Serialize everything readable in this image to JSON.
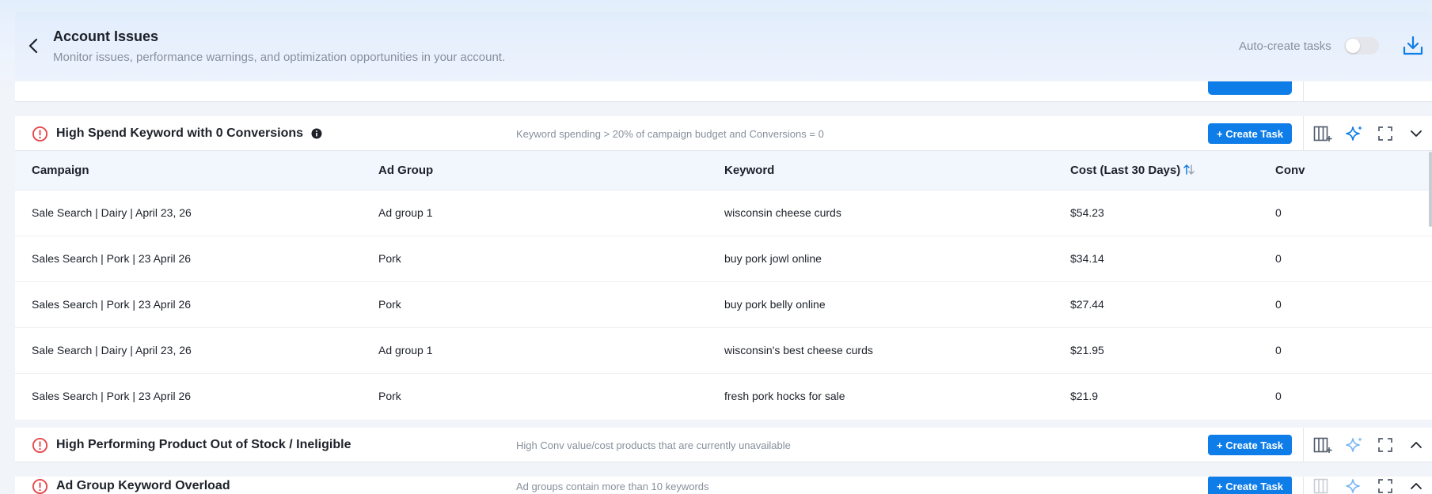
{
  "header": {
    "title": "Account Issues",
    "subtitle": "Monitor issues, performance warnings, and optimization opportunities in your account.",
    "auto_create_label": "Auto-create tasks",
    "auto_create_enabled": false
  },
  "colors": {
    "accent": "#0e7de8",
    "danger": "#e5484d",
    "muted_text": "#86909c"
  },
  "panels": [
    {
      "title": "High Spend Keyword with 0 Conversions",
      "description": "Keyword spending > 20% of campaign budget and Conversions = 0",
      "create_label": "+ Create Task",
      "expanded": true,
      "columns": [
        "Campaign",
        "Ad Group",
        "Keyword",
        "Cost (Last 30 Days)",
        "Conv"
      ],
      "rows": [
        [
          "Sale Search | Dairy | April 23, 26",
          "Ad group 1",
          "wisconsin cheese curds",
          "$54.23",
          "0"
        ],
        [
          "Sales Search | Pork | 23 April 26",
          "Pork",
          "buy pork jowl online",
          "$34.14",
          "0"
        ],
        [
          "Sales Search | Pork | 23 April 26",
          "Pork",
          "buy pork belly online",
          "$27.44",
          "0"
        ],
        [
          "Sale Search | Dairy | April 23, 26",
          "Ad group 1",
          "wisconsin's best cheese curds",
          "$21.95",
          "0"
        ],
        [
          "Sales Search | Pork | 23 April 26",
          "Pork",
          "fresh pork hocks for sale",
          "$21.9",
          "0"
        ]
      ]
    },
    {
      "title": "High Performing Product Out of Stock / Ineligible",
      "description": "High Conv value/cost products that are currently unavailable",
      "create_label": "+ Create Task",
      "expanded": false
    },
    {
      "title": "Ad Group Keyword Overload",
      "description": "Ad groups contain more than 10 keywords",
      "create_label": "+ Create Task",
      "expanded": false
    }
  ]
}
